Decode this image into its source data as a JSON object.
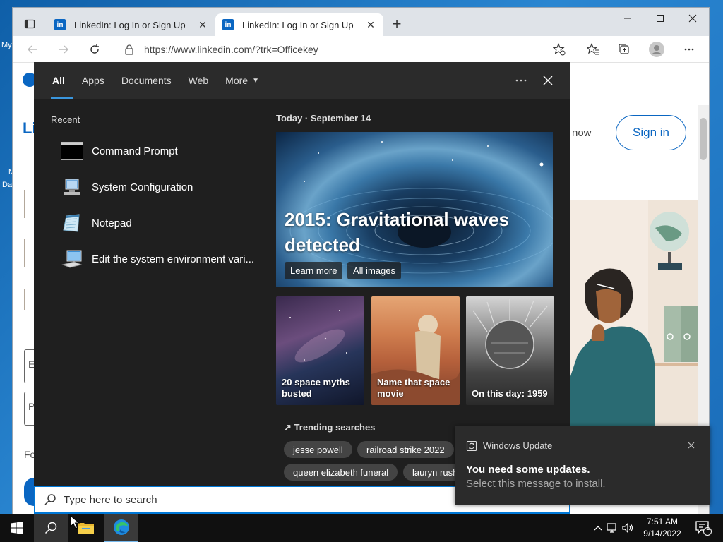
{
  "browser": {
    "tabs": [
      {
        "title": "LinkedIn: Log In or Sign Up",
        "favicon": "in"
      },
      {
        "title": "LinkedIn: Log In or Sign Up",
        "favicon": "in"
      }
    ],
    "url": "https://www.linkedin.com/?trk=Officekey"
  },
  "linkedin": {
    "sign_in": "Sign in",
    "join_fragment": "now",
    "left_fragments": {
      "logo": "Li",
      "form_e": "E",
      "form_p": "P",
      "fo": "Fo"
    }
  },
  "desktop": {
    "frag_my": "My",
    "frag_d": "Da",
    "frag_m": "M"
  },
  "search_panel": {
    "tabs": [
      "All",
      "Apps",
      "Documents",
      "Web",
      "More"
    ],
    "recent_heading": "Recent",
    "recent": [
      {
        "label": "Command Prompt",
        "icon": "command-prompt-icon"
      },
      {
        "label": "System Configuration",
        "icon": "system-configuration-icon"
      },
      {
        "label": "Notepad",
        "icon": "notepad-icon"
      },
      {
        "label": "Edit the system environment vari...",
        "icon": "system-properties-icon"
      }
    ],
    "today_heading": "Today · September 14",
    "hero": {
      "title": "2015: Gravitational waves detected",
      "learn_more": "Learn more",
      "all_images": "All images"
    },
    "cards": [
      {
        "label": "20 space myths busted"
      },
      {
        "label": "Name that space movie"
      },
      {
        "label": "On this day: 1959"
      }
    ],
    "trending_heading": "Trending searches",
    "trending": [
      "jesse powell",
      "railroad strike 2022",
      "queen elizabeth funeral",
      "lauryn rush"
    ]
  },
  "search_bar": {
    "placeholder": "Type here to search"
  },
  "toast": {
    "app": "Windows Update",
    "title": "You need some updates.",
    "body": "Select this message to install."
  },
  "taskbar": {
    "time": "7:51 AM",
    "date": "9/14/2022",
    "notification_count": "1"
  },
  "colors": {
    "accent": "#0078d7",
    "linkedin_blue": "#0a66c2",
    "panel_bg": "#1f1f1f"
  }
}
